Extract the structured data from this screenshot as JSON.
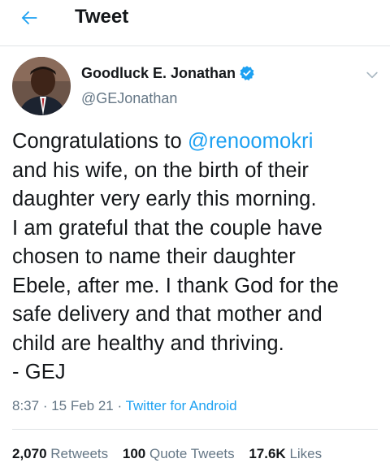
{
  "header": {
    "title": "Tweet",
    "back_icon": "arrow-left-icon",
    "accent_color": "#1da1f2"
  },
  "author": {
    "name": "Goodluck E. Jonathan",
    "handle": "@GEJonathan",
    "verified": true,
    "verified_icon": "verified-badge-icon",
    "menu_icon": "chevron-down-icon"
  },
  "tweet": {
    "lines": [
      {
        "mention": "@renoomokri",
        "text": "Congratulations to "
      },
      {
        "text": "and his wife, on the birth of their"
      },
      {
        "text": "daughter very early this morning."
      },
      {
        "text": "I am grateful that the couple have"
      },
      {
        "text": "chosen to name their daughter"
      },
      {
        "text": "Ebele, after me. I thank God for the"
      },
      {
        "text": "safe delivery and that mother and"
      },
      {
        "text": "child are healthy and thriving."
      },
      {
        "text": "- GEJ"
      }
    ]
  },
  "meta": {
    "time": "8:37",
    "separator": " · ",
    "date": "15 Feb 21",
    "source": "Twitter for Android"
  },
  "stats": {
    "retweets_count": "2,070",
    "retweets_label": "Retweets",
    "quotes_count": "100",
    "quotes_label": "Quote Tweets",
    "likes_count": "17.6K",
    "likes_label": "Likes"
  },
  "colors": {
    "text": "#14171a",
    "secondary": "#657786",
    "link": "#1da1f2",
    "divider": "#dfe3e6"
  }
}
